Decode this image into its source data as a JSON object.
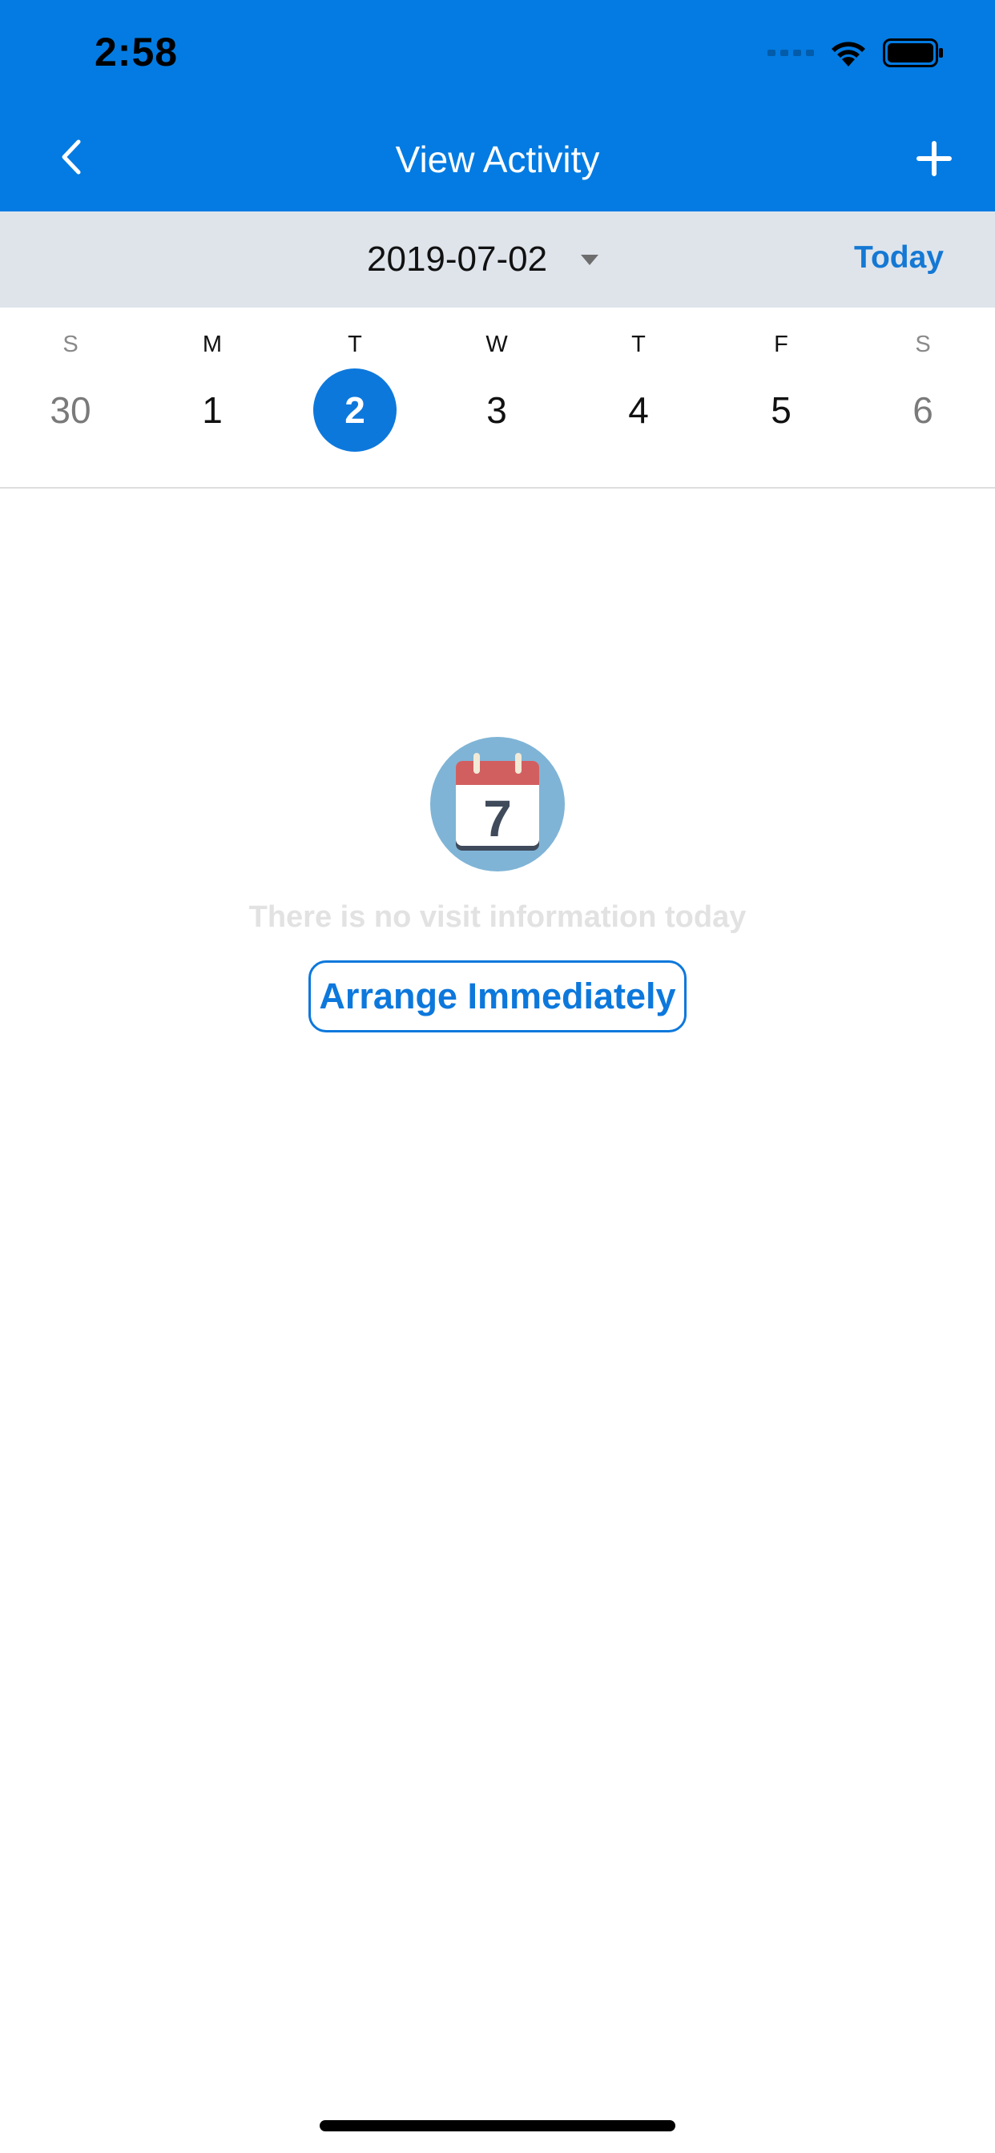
{
  "status_bar": {
    "time": "2:58"
  },
  "nav": {
    "title": "View Activity"
  },
  "date_bar": {
    "selected_date": "2019-07-02",
    "today_label": "Today"
  },
  "week": {
    "days": [
      {
        "letter": "S",
        "number": "30",
        "weekend": true
      },
      {
        "letter": "M",
        "number": "1",
        "weekend": false
      },
      {
        "letter": "T",
        "number": "2",
        "weekend": false,
        "selected": true
      },
      {
        "letter": "W",
        "number": "3",
        "weekend": false
      },
      {
        "letter": "T",
        "number": "4",
        "weekend": false
      },
      {
        "letter": "F",
        "number": "5",
        "weekend": false
      },
      {
        "letter": "S",
        "number": "6",
        "weekend": true
      }
    ]
  },
  "empty_state": {
    "illustration_number": "7",
    "message": "There is no visit information today",
    "action_label": "Arrange Immediately"
  },
  "colors": {
    "primary": "#037be2",
    "accent": "#0d78dc",
    "date_bar_bg": "#dfe4eb",
    "empty_text": "#e2e2e2"
  },
  "icons": {
    "back": "chevron-left-icon",
    "add": "plus-icon",
    "date_dropdown": "caret-down-icon",
    "wifi": "wifi-icon",
    "battery": "battery-icon",
    "empty_illustration": "calendar-icon"
  }
}
